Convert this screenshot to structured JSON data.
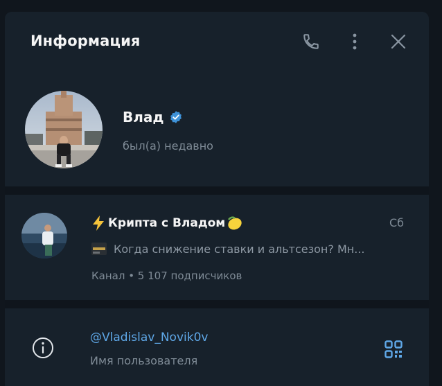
{
  "header": {
    "title": "Информация",
    "call_icon": "phone-icon",
    "menu_icon": "more-vertical-icon",
    "close_icon": "close-icon"
  },
  "profile": {
    "name": "Влад",
    "verified_icon": "verified-badge-icon",
    "status": "был(а) недавно"
  },
  "channel": {
    "title_icon": "lightning-emoji",
    "title": "Крипта с Владом",
    "title_emoji": "lemon-emoji",
    "date": "Сб",
    "message_preview": "Когда снижение ставки и альтсезон?   Мн...",
    "subtitle": "Канал • 5 107 подписчиков"
  },
  "info": {
    "icon": "info-circle-icon",
    "username": "@Vladislav_Novik0v",
    "username_label": "Имя пользователя",
    "qr_icon": "qr-code-icon"
  },
  "colors": {
    "panel_bg": "#17212b",
    "divider": "#0f151c",
    "accent": "#5fa8e8",
    "verified": "#3e92d8",
    "muted_text": "#7f8b96"
  }
}
